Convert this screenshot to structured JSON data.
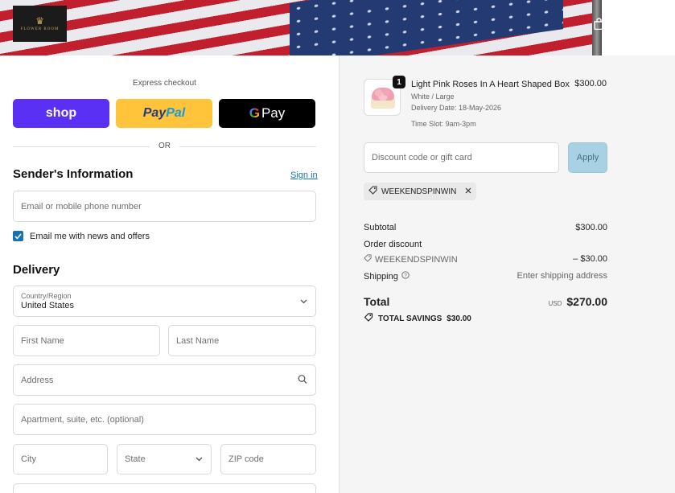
{
  "header": {
    "logo_text": "FLOWER ROOM",
    "cart_icon": "shopping-bag-icon"
  },
  "checkout": {
    "express_label": "Express checkout",
    "shop_label": "shop",
    "paypal_label_a": "Pay",
    "paypal_label_b": "Pal",
    "gpay_label_g": "G",
    "gpay_label": "Pay",
    "or_label": "OR",
    "sender": {
      "title": "Sender's Information",
      "signin_label": "Sign in",
      "email_placeholder": "Email or mobile phone number",
      "newsletter_label": "Email me with news and offers",
      "newsletter_checked": true
    },
    "delivery": {
      "title": "Delivery",
      "country_label": "Country/Region",
      "country_value": "United States",
      "first_name": "First Name",
      "last_name": "Last Name",
      "address": "Address",
      "apartment": "Apartment, suite, etc. (optional)",
      "city": "City",
      "state": "State",
      "zip": "ZIP code"
    }
  },
  "summary": {
    "item": {
      "quantity": "1",
      "name": "Light Pink Roses In A Heart Shaped Box",
      "variant": "White / Large",
      "delivery_date": "Delivery Date: 18-May-2026",
      "time_slot": "Time Slot: 9am-3pm",
      "price": "$300.00"
    },
    "discount_placeholder": "Discount code or gift card",
    "apply_label": "Apply",
    "applied_code": "WEEKENDSPINWIN",
    "subtotal_label": "Subtotal",
    "subtotal_value": "$300.00",
    "order_discount_label": "Order discount",
    "discount_code": "WEEKENDSPINWIN",
    "discount_value": "– $30.00",
    "shipping_label": "Shipping",
    "shipping_value": "Enter shipping address",
    "total_label": "Total",
    "currency": "USD",
    "total_value": "$270.00",
    "savings_label": "TOTAL SAVINGS",
    "savings_value": "$30.00"
  },
  "colors": {
    "shop": "#5a31f4",
    "paypal": "#ffc439",
    "gpay": "#000000",
    "link": "#1773b0",
    "apply": "#a8d2e3"
  }
}
